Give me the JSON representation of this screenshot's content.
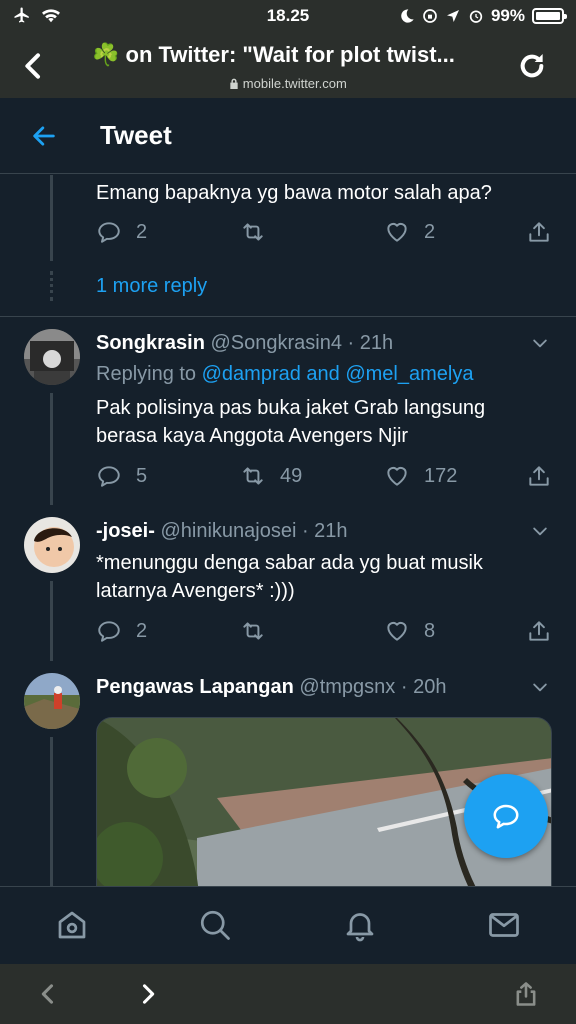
{
  "status": {
    "time": "18.25",
    "battery": "99%"
  },
  "browser": {
    "page_title": "☘️ on Twitter: \"Wait for plot twist...",
    "domain": "mobile.twitter.com"
  },
  "header": {
    "title": "Tweet"
  },
  "thread": {
    "top_reply_text": "Emang bapaknya yg bawa motor salah apa?",
    "top_reply_counts": {
      "replies": "2",
      "retweets": "",
      "likes": "2"
    },
    "more_replies": "1 more reply"
  },
  "tweets": [
    {
      "name": "Songkrasin",
      "handle": "@Songkrasin4 · 21h",
      "replying_prefix": "Replying to",
      "replying_to": "@damprad and @mel_amelya",
      "text_line1": "Pak polisinya pas buka jaket Grab langsung",
      "text_line2": "berasa kaya Anggota Avengers Njir",
      "replies": "5",
      "retweets": "49",
      "likes": "172"
    },
    {
      "name": "-josei-",
      "handle": "@hinikunajosei · 21h",
      "text_line1": "*menunggu denga  sabar ada yg buat musik",
      "text_line2": "latarnya Avengers* :)))",
      "replies": "2",
      "retweets": "",
      "likes": "8"
    },
    {
      "name": "Pengawas Lapangan",
      "handle": "@tmpgsnx · 20h"
    }
  ],
  "colors": {
    "background": "#15202b",
    "accent": "#1da1f2",
    "muted": "#8899a6",
    "divider": "#38444d",
    "chrome": "#2b2f2c"
  }
}
